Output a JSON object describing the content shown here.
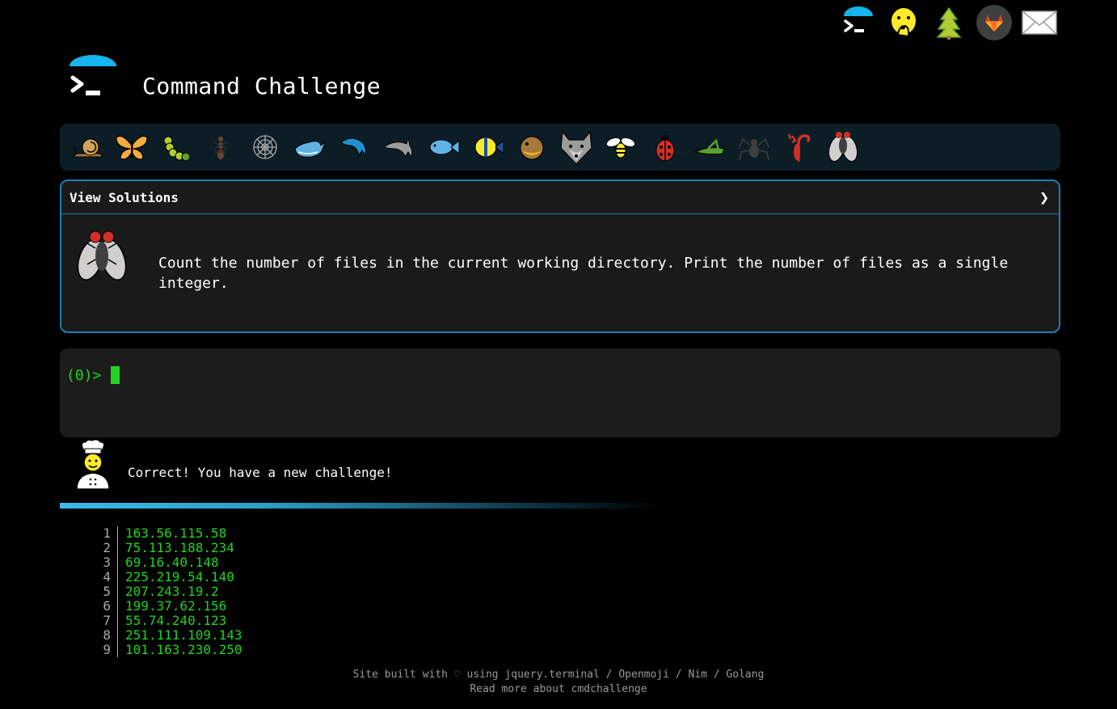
{
  "header": {
    "title": "Command Challenge"
  },
  "topbar": {
    "icons": [
      "terminal-logo-icon",
      "shushing-face-icon",
      "tree-icon",
      "gitlab-icon",
      "mail-icon"
    ]
  },
  "levels": [
    "snail",
    "butterfly",
    "caterpillar",
    "ant",
    "spider-web",
    "whale",
    "dolphin",
    "dolphin-2",
    "fish",
    "tropical-fish",
    "blowfish",
    "wolf",
    "bee",
    "ladybug",
    "grasshopper",
    "spider",
    "scorpion",
    "fly"
  ],
  "challenge": {
    "view_solutions": "View Solutions",
    "chevron": "❯",
    "text": "Count the number of files in the current working directory. Print the number of files as a single integer."
  },
  "terminal": {
    "prompt": "(0)>"
  },
  "feedback": {
    "text": "Correct! You have a new challenge!"
  },
  "progress": 0.6,
  "output": [
    {
      "n": "1",
      "v": "163.56.115.58"
    },
    {
      "n": "2",
      "v": "75.113.188.234"
    },
    {
      "n": "3",
      "v": "69.16.40.148"
    },
    {
      "n": "4",
      "v": "225.219.54.140"
    },
    {
      "n": "5",
      "v": "207.243.19.2"
    },
    {
      "n": "6",
      "v": "199.37.62.156"
    },
    {
      "n": "7",
      "v": "55.74.240.123"
    },
    {
      "n": "8",
      "v": "251.111.109.143"
    },
    {
      "n": "9",
      "v": "101.163.230.250"
    }
  ],
  "footer": {
    "built_prefix": "Site built with ♡ using ",
    "jquery_terminal": "jquery.terminal",
    "sep": " / ",
    "openmoji": "Openmoji",
    "nim": "Nim",
    "golang": "Golang",
    "read_more": "Read more about cmdchallenge"
  },
  "colors": {
    "accent": "#1e7fae",
    "terminal_green": "#1fd51f",
    "logo_blue": "#16b4ec"
  }
}
